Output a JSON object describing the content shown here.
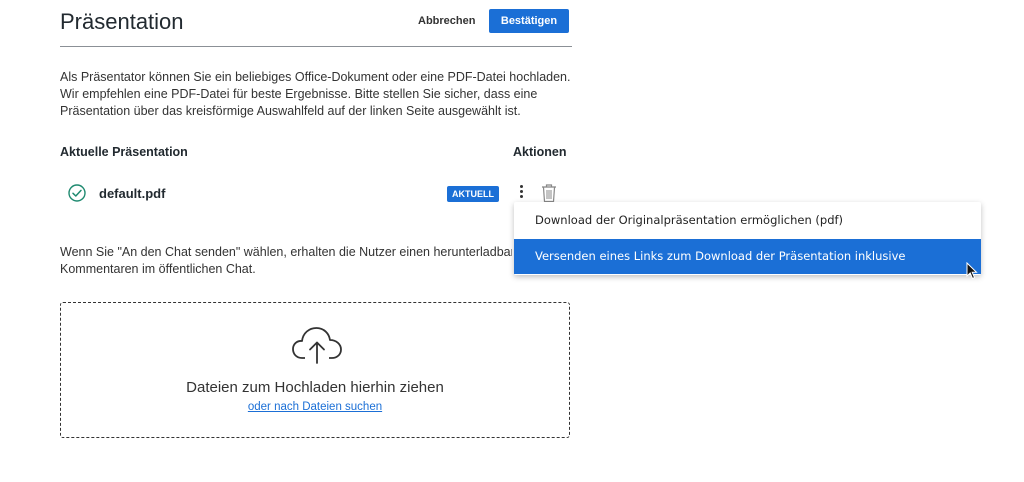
{
  "header": {
    "title": "Präsentation",
    "cancel_label": "Abbrechen",
    "confirm_label": "Bestätigen"
  },
  "intro_text": "Als Präsentator können Sie ein beliebiges Office-Dokument oder eine PDF-Datei hochladen. Wir empfehlen eine PDF-Datei für beste Ergebnisse. Bitte stellen Sie sicher, dass eine Präsentation über das kreisförmige Auswahlfeld auf der linken Seite ausgewählt ist.",
  "table": {
    "col_current": "Aktuelle Präsentation",
    "col_actions": "Aktionen",
    "rows": [
      {
        "name": "default.pdf",
        "badge": "AKTUELL",
        "icon": "check-circle-icon"
      }
    ]
  },
  "send_text": "Wenn Sie \"An den Chat senden\" wählen, erhalten die Nutzer einen herunterladbaren L",
  "send_text_line2": "Kommentaren im öffentlichen Chat.",
  "dropzone": {
    "icon": "cloud-upload-icon",
    "text": "Dateien zum Hochladen hierhin ziehen",
    "link": "oder nach Dateien suchen"
  },
  "menu": {
    "items": [
      "Download der Originalpräsentation ermöglichen (pdf)",
      "Versenden eines Links zum Download der Präsentation inklusive Anmerkungen"
    ]
  },
  "colors": {
    "accent": "#1b6fd6",
    "check": "#1f8a70",
    "text": "#333333"
  }
}
